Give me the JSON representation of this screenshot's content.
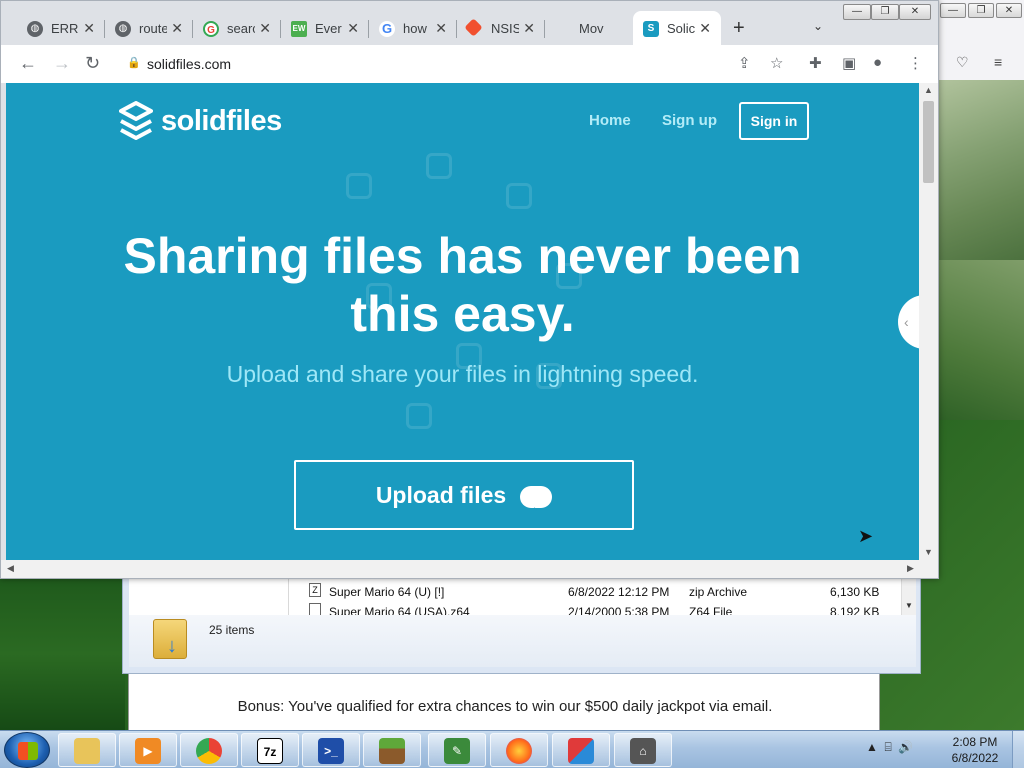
{
  "browser": {
    "tabs": [
      {
        "title": "ERRO",
        "icon": "globe-icon"
      },
      {
        "title": "route",
        "icon": "globe-icon"
      },
      {
        "title": "searc",
        "icon": "google-icon"
      },
      {
        "title": "Ever",
        "icon": "evernote-icon"
      },
      {
        "title": "how",
        "icon": "google-icon"
      },
      {
        "title": "NSIS",
        "icon": "git-icon"
      },
      {
        "title": "Mov",
        "icon": "blank-icon"
      },
      {
        "title": "Solic",
        "icon": "solidfiles-icon"
      }
    ],
    "url": "solidfiles.com"
  },
  "page": {
    "logo_text": "solidfiles",
    "nav": {
      "home": "Home",
      "signup": "Sign up",
      "signin": "Sign in"
    },
    "hero_line1": "Sharing files has never been",
    "hero_line2": "this easy.",
    "subtitle": "Upload and share your files in lightning speed.",
    "upload_label": "Upload files",
    "accent_color": "#1a9bc0"
  },
  "explorer": {
    "files": [
      {
        "name": "Super Mario 64 (U) [!]",
        "date": "6/8/2022 12:12 PM",
        "type": "zip Archive",
        "size": "6,130 KB"
      },
      {
        "name": "Super Mario 64 (USA).z64",
        "date": "2/14/2000 5:38 PM",
        "type": "Z64 File",
        "size": "8,192 KB"
      }
    ],
    "item_count": "25 items"
  },
  "background_page": {
    "bonus_text": "Bonus: You've qualified for extra chances to win our $500 daily jackpot via email."
  },
  "taskbar": {
    "time": "2:08 PM",
    "date": "6/8/2022"
  }
}
